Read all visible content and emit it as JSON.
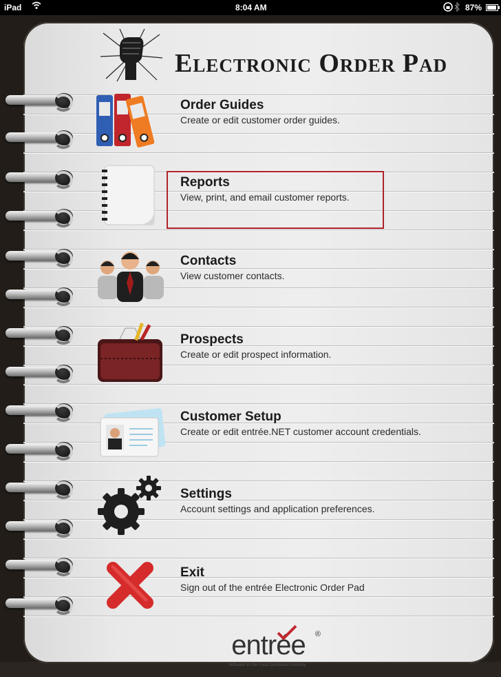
{
  "status_bar": {
    "device": "iPad",
    "time": "8:04 AM",
    "battery": "87%"
  },
  "app": {
    "title": "Electronic Order Pad"
  },
  "menu": [
    {
      "label": "Order Guides",
      "desc": "Create or edit customer order guides.",
      "icon": "binders-icon"
    },
    {
      "label": "Reports",
      "desc": "View, print, and email customer reports.",
      "icon": "notebook-icon"
    },
    {
      "label": "Contacts",
      "desc": "View customer contacts.",
      "icon": "people-icon"
    },
    {
      "label": "Prospects",
      "desc": "Create or edit prospect information.",
      "icon": "briefcase-icon"
    },
    {
      "label": "Customer Setup",
      "desc": "Create or edit entrée.NET customer account credentials.",
      "icon": "id-card-icon"
    },
    {
      "label": "Settings",
      "desc": "Account settings and application preferences.",
      "icon": "gear-icon"
    },
    {
      "label": "Exit",
      "desc": "Sign out of the entrée Electronic Order Pad",
      "icon": "red-x-icon"
    }
  ],
  "footer": {
    "brand": "entrée",
    "reg": "®",
    "tagline": "Software for the Food Distribution Industry"
  },
  "colors": {
    "accent": "#b0212a",
    "paper": "#eeeeee"
  }
}
